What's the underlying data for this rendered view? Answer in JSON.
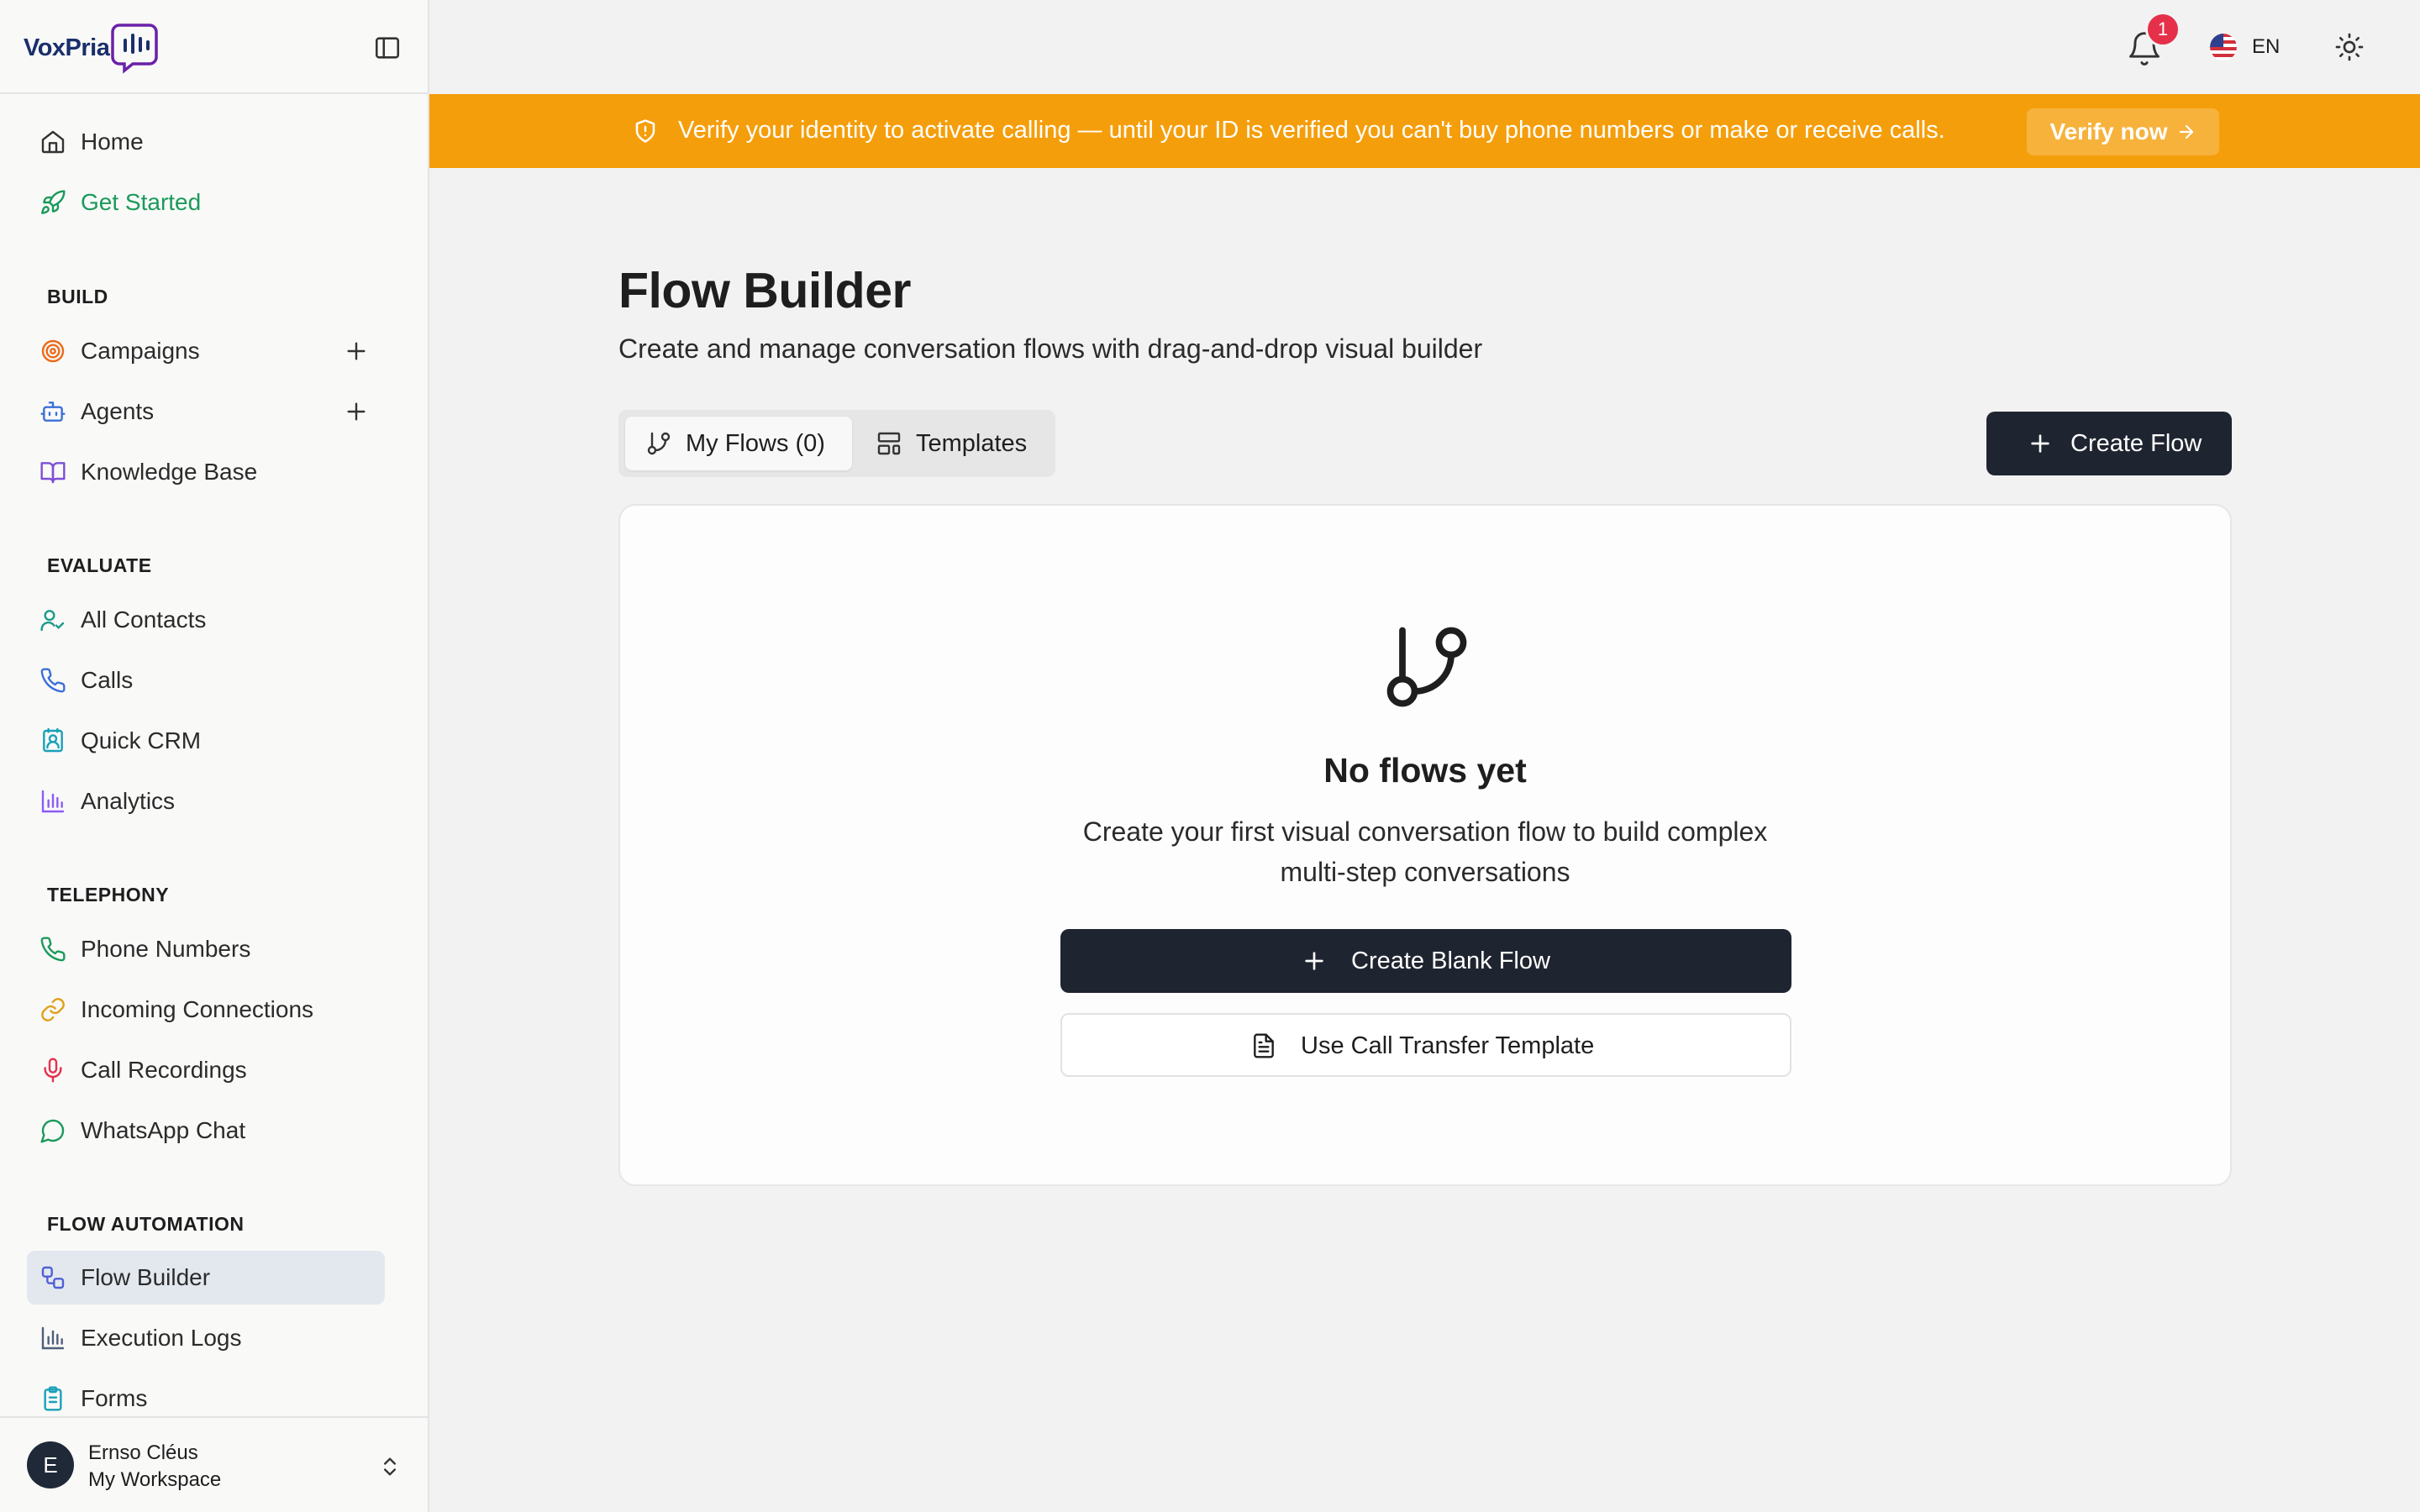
{
  "brand": {
    "name": "VoxPria"
  },
  "sidebar": {
    "top_items": [
      {
        "label": "Home",
        "icon": "home-icon"
      },
      {
        "label": "Get Started",
        "icon": "rocket-icon",
        "color": "#1a9a5a"
      }
    ],
    "sections": [
      {
        "title": "BUILD",
        "items": [
          {
            "label": "Campaigns",
            "icon": "target-icon",
            "has_add": true
          },
          {
            "label": "Agents",
            "icon": "bot-icon",
            "has_add": true
          },
          {
            "label": "Knowledge Base",
            "icon": "book-icon"
          }
        ]
      },
      {
        "title": "EVALUATE",
        "items": [
          {
            "label": "All Contacts",
            "icon": "user-check-icon"
          },
          {
            "label": "Calls",
            "icon": "phone-icon"
          },
          {
            "label": "Quick CRM",
            "icon": "contact-card-icon"
          },
          {
            "label": "Analytics",
            "icon": "bar-chart-icon"
          }
        ]
      },
      {
        "title": "TELEPHONY",
        "items": [
          {
            "label": "Phone Numbers",
            "icon": "phone-icon"
          },
          {
            "label": "Incoming Connections",
            "icon": "link-icon"
          },
          {
            "label": "Call Recordings",
            "icon": "mic-icon"
          },
          {
            "label": "WhatsApp Chat",
            "icon": "chat-bubble-icon"
          }
        ]
      },
      {
        "title": "FLOW AUTOMATION",
        "items": [
          {
            "label": "Flow Builder",
            "icon": "workflow-icon",
            "active": true
          },
          {
            "label": "Execution Logs",
            "icon": "bar-chart-icon"
          },
          {
            "label": "Forms",
            "icon": "clipboard-icon"
          }
        ]
      }
    ],
    "user": {
      "initial": "E",
      "name": "Ernso Cléus",
      "workspace": "My Workspace"
    }
  },
  "topbar": {
    "notifications_count": "1",
    "language": "EN"
  },
  "banner": {
    "text": "Verify your identity to activate calling — until your ID is verified you can't buy phone numbers or make or receive calls.",
    "button": "Verify now",
    "color": "#f59e0b"
  },
  "main": {
    "title": "Flow Builder",
    "subtitle": "Create and manage conversation flows with drag-and-drop visual builder",
    "tabs": [
      {
        "label": "My Flows (0)",
        "icon": "git-branch-icon",
        "selected": true
      },
      {
        "label": "Templates",
        "icon": "layout-template-icon",
        "selected": false
      }
    ],
    "create_button": "Create Flow",
    "empty_state": {
      "icon": "git-branch-icon",
      "title": "No flows yet",
      "description": "Create your first visual conversation flow to build complex multi-step conversations",
      "primary_button": "Create Blank Flow",
      "secondary_button": "Use Call Transfer Template"
    }
  }
}
